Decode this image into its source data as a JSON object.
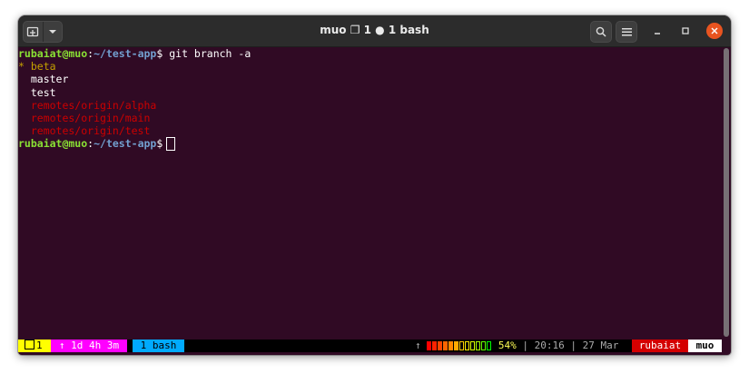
{
  "window": {
    "title": "muo ❐ 1 ● 1 bash"
  },
  "terminal": {
    "prompt": {
      "user_host": "rubaiat@muo",
      "colon": ":",
      "path": "~/test-app",
      "dollar": "$"
    },
    "command": "git branch -a",
    "output": [
      {
        "text": "* beta",
        "color": "#c4a000"
      },
      {
        "text": "  master",
        "color": "#ffffff"
      },
      {
        "text": "  test",
        "color": "#ffffff"
      },
      {
        "text": "  remotes/origin/alpha",
        "color": "#cc0000"
      },
      {
        "text": "  remotes/origin/main",
        "color": "#cc0000"
      },
      {
        "text": "  remotes/origin/test",
        "color": "#cc0000"
      }
    ]
  },
  "tmux_status": {
    "window_index": "1",
    "uptime": "↑ 1d 4h 3m",
    "active_window": "1 bash",
    "up_arrow": "↑",
    "battery_percent": "54%",
    "battery_level": 0.54,
    "time": "20:16",
    "date": "27 Mar",
    "user": "rubaiat",
    "host": "muo",
    "separator": "|"
  },
  "colors": {
    "terminal_bg": "#300a24",
    "prompt_user": "#8ae234",
    "prompt_path": "#729fcf",
    "close_button": "#e95420"
  },
  "icons": {
    "new_tab": "new-tab-icon",
    "dropdown": "chevron-down-icon",
    "search": "search-icon",
    "menu": "hamburger-menu-icon",
    "minimize": "minimize-icon",
    "maximize": "maximize-icon",
    "close": "close-icon"
  }
}
